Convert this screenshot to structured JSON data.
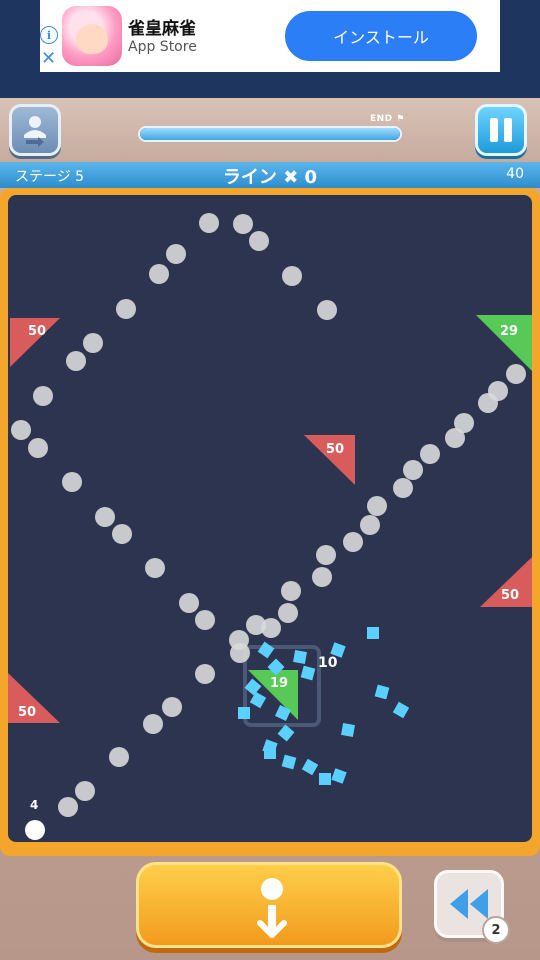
{
  "ad": {
    "app_name": "雀皇麻雀",
    "store": "App Store",
    "install_label": "インストール",
    "info_glyph": "i",
    "close_glyph": "✕"
  },
  "header": {
    "end_label": "END",
    "progress": 1.0
  },
  "stage": {
    "label": "ステージ 5",
    "line_label": "ライン ✖ 0",
    "score": "40"
  },
  "board": {
    "ball_count_label": "4",
    "blocks": [
      {
        "id": "left-top",
        "value": "50",
        "color": "#d95c5c"
      },
      {
        "id": "right-top",
        "value": "29",
        "color": "#57c957"
      },
      {
        "id": "center",
        "value": "50",
        "color": "#d95c5c"
      },
      {
        "id": "right-mid",
        "value": "50",
        "color": "#d95c5c"
      },
      {
        "id": "left-bottom",
        "value": "50",
        "color": "#d95c5c"
      },
      {
        "id": "center-green",
        "value": "19",
        "color": "#57c957"
      }
    ],
    "hit_number": "10"
  },
  "controls": {
    "rewind_count": "2"
  },
  "colors": {
    "board_bg": "#2c3450",
    "frame": "#f4a52c",
    "accent": "#2c7ef6",
    "particle": "#5bd0ff"
  },
  "icons": {
    "share": "player-swap-icon",
    "pause": "pause-icon",
    "drop": "drop-ball-icon",
    "rewind": "rewind-icon"
  }
}
